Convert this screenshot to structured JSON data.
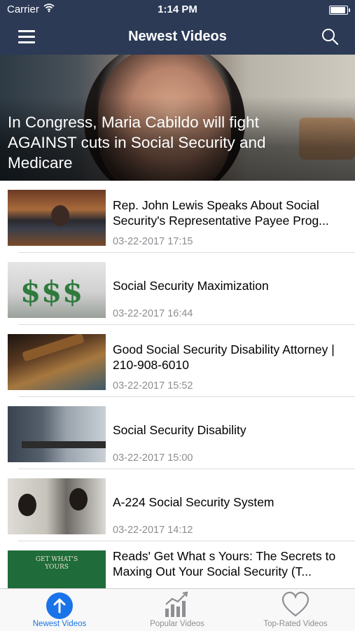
{
  "status_bar": {
    "carrier": "Carrier",
    "time": "1:14 PM",
    "wifi_icon": "wifi-icon",
    "battery_icon": "battery-icon"
  },
  "nav": {
    "title": "Newest Videos",
    "menu_icon": "hamburger-menu-icon",
    "search_icon": "search-icon",
    "bar_color": "#2c3a56"
  },
  "featured": {
    "title": "In Congress, Maria Cabildo will fight AGAINST cuts in Social Security and Medicare"
  },
  "videos": [
    {
      "title": "Rep. John Lewis Speaks About Social Security's Representative Payee Prog...",
      "date": "03-22-2017 17:15"
    },
    {
      "title": "Social Security Maximization",
      "date": "03-22-2017 16:44"
    },
    {
      "title": "Good Social Security Disability Attorney | 210-908-6010",
      "date": "03-22-2017 15:52"
    },
    {
      "title": "Social Security Disability",
      "date": "03-22-2017 15:00"
    },
    {
      "title": "A-224 Social Security System",
      "date": "03-22-2017 14:12"
    },
    {
      "title": "Reads' Get What s Yours: The Secrets to Maxing Out Your Social Security (T...",
      "date": ""
    }
  ],
  "thumb_text": {
    "book_cover": "GET WHAT'S YOURS"
  },
  "tabs": [
    {
      "label": "Newest Videos",
      "icon": "arrow-up-circle-icon",
      "active": true
    },
    {
      "label": "Popular Videos",
      "icon": "trending-chart-icon",
      "active": false
    },
    {
      "label": "Top-Rated Videos",
      "icon": "heart-icon",
      "active": false
    }
  ],
  "colors": {
    "accent": "#1a73e8",
    "inactive": "#8e8e93",
    "date": "#8e8e93"
  }
}
